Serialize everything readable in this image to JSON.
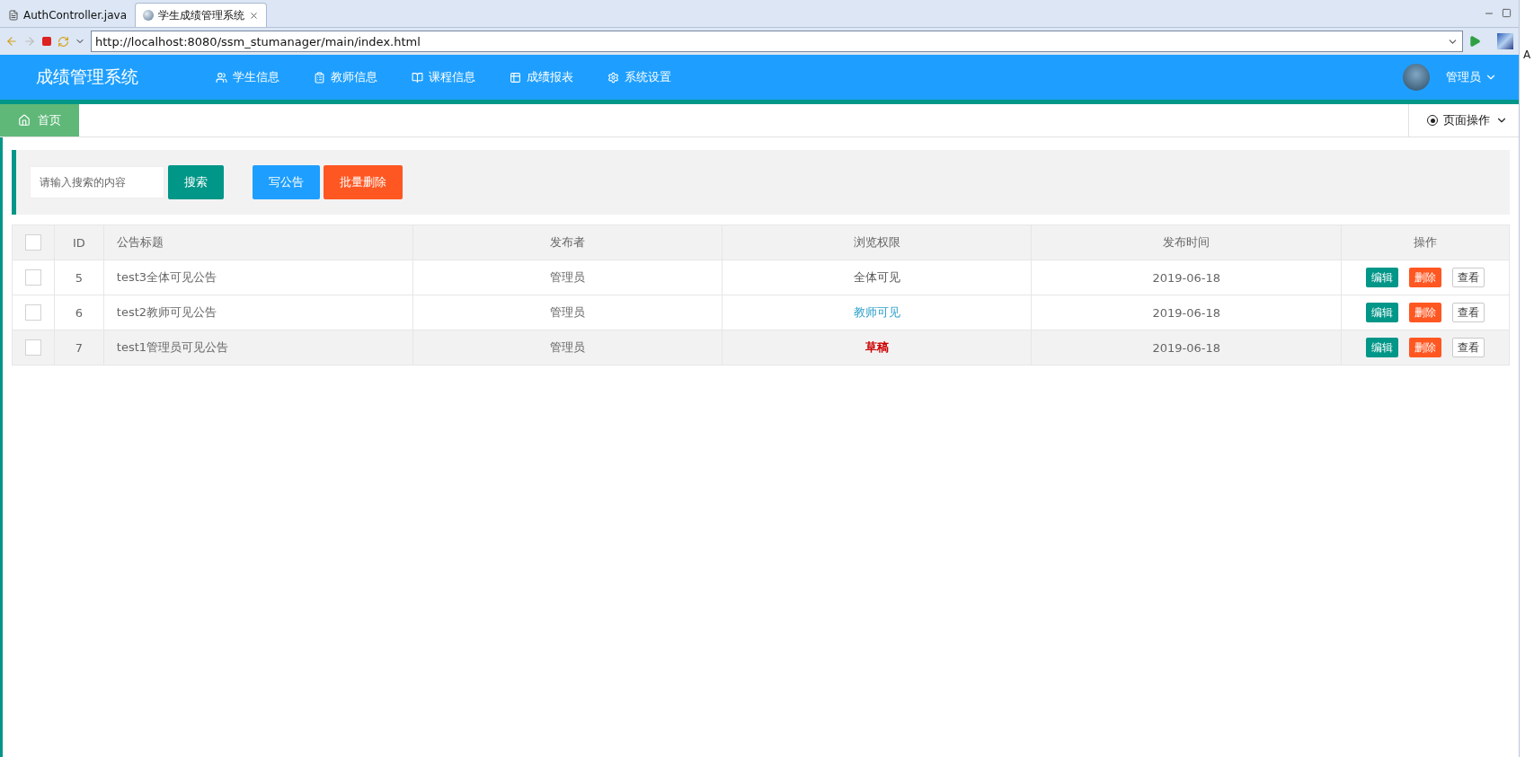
{
  "editor_tabs": [
    {
      "label": "AuthController.java",
      "kind": "file",
      "selected": false
    },
    {
      "label": "学生成绩管理系统",
      "kind": "web",
      "selected": true
    }
  ],
  "address_bar": {
    "url": "http://localhost:8080/ssm_stumanager/main/index.html"
  },
  "side_strip": {
    "text": "A"
  },
  "app": {
    "brand": "成绩管理系统",
    "nav": [
      {
        "label": "学生信息"
      },
      {
        "label": "教师信息"
      },
      {
        "label": "课程信息"
      },
      {
        "label": "成绩报表"
      },
      {
        "label": "系统设置"
      }
    ],
    "user": {
      "name": "管理员"
    },
    "page_tabs": [
      {
        "label": "首页",
        "selected": true
      }
    ],
    "page_ops": "页面操作",
    "toolbar": {
      "search_placeholder": "请输入搜索的内容",
      "buttons": [
        {
          "label": "搜索",
          "kind": "teal"
        },
        {
          "label": "写公告",
          "kind": "blue"
        },
        {
          "label": "批量删除",
          "kind": "orange"
        }
      ]
    },
    "table": {
      "header_checked": false,
      "columns": [
        "ID",
        "公告标题",
        "发布者",
        "浏览权限",
        "发布时间",
        "操作"
      ],
      "rows": [
        {
          "checked": false,
          "selected": false,
          "id": "5",
          "title": "test3全体可见公告",
          "publisher": "管理员",
          "permission": {
            "text": "全体可见",
            "kind": "all"
          },
          "date": "2019-06-18",
          "actions": [
            {
              "label": "编辑",
              "kind": "teal"
            },
            {
              "label": "删除",
              "kind": "orange"
            },
            {
              "label": "查看",
              "kind": "plain"
            }
          ]
        },
        {
          "checked": false,
          "selected": false,
          "id": "6",
          "title": "test2教师可见公告",
          "publisher": "管理员",
          "permission": {
            "text": "教师可见",
            "kind": "teacher"
          },
          "date": "2019-06-18",
          "actions": [
            {
              "label": "编辑",
              "kind": "teal"
            },
            {
              "label": "删除",
              "kind": "orange"
            },
            {
              "label": "查看",
              "kind": "plain"
            }
          ]
        },
        {
          "checked": false,
          "selected": true,
          "id": "7",
          "title": "test1管理员可见公告",
          "publisher": "管理员",
          "permission": {
            "text": "草稿",
            "kind": "draft"
          },
          "date": "2019-06-18",
          "actions": [
            {
              "label": "编辑",
              "kind": "teal"
            },
            {
              "label": "删除",
              "kind": "orange"
            },
            {
              "label": "查看",
              "kind": "plain"
            }
          ]
        }
      ]
    }
  }
}
